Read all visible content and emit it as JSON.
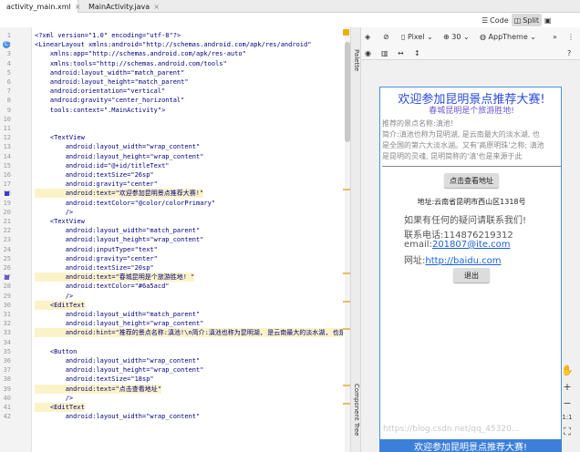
{
  "tabs": [
    {
      "label": "activity_main.xml",
      "close": "×",
      "icon": "xml-file-icon"
    },
    {
      "label": "MainActivity.java",
      "close": "×",
      "icon": "java-class-icon"
    }
  ],
  "view_modes": {
    "code": "Code",
    "split": "Split",
    "design": "Design"
  },
  "design_toolbar": {
    "device": "Pixel",
    "api": "30",
    "theme": "AppTheme",
    "help": "?"
  },
  "side_tabs": {
    "palette": "Palette",
    "component_tree": "Component Tree"
  },
  "line_numbers": [
    "1",
    "2",
    "3",
    "4",
    "5",
    "6",
    "7",
    "8",
    "9",
    "10",
    "11",
    "12",
    "13",
    "14",
    "15",
    "16",
    "17",
    "18",
    "19",
    "20",
    "21",
    "22",
    "23",
    "24",
    "25",
    "26",
    "27",
    "28",
    "29",
    "30",
    "31",
    "32",
    "33",
    "34",
    "35",
    "36",
    "37",
    "38",
    "39",
    "40",
    "41",
    "42",
    "43",
    "44"
  ],
  "code_lines": [
    {
      "text": "<?xml version=\"1.0\" encoding=\"utf-8\"?>",
      "hl": false
    },
    {
      "text": "<LinearLayout xmlns:android=\"http://schemas.android.com/apk/res/android\"",
      "hl": false
    },
    {
      "text": "    xmlns:app=\"http://schemas.android.com/apk/res-auto\"",
      "hl": false
    },
    {
      "text": "    xmlns:tools=\"http://schemas.android.com/tools\"",
      "hl": false
    },
    {
      "text": "    android:layout_width=\"match_parent\"",
      "hl": false
    },
    {
      "text": "    android:layout_height=\"match_parent\"",
      "hl": false
    },
    {
      "text": "    android:orientation=\"vertical\"",
      "hl": false
    },
    {
      "text": "    android:gravity=\"center_horizontal\"",
      "hl": false
    },
    {
      "text": "    tools:context=\".MainActivity\">",
      "hl": false
    },
    {
      "text": "",
      "hl": false
    },
    {
      "text": "",
      "hl": false
    },
    {
      "text": "    <TextView",
      "hl": false
    },
    {
      "text": "        android:layout_width=\"wrap_content\"",
      "hl": false
    },
    {
      "text": "        android:layout_height=\"wrap_content\"",
      "hl": false
    },
    {
      "text": "        android:id=\"@+id/titleText\"",
      "hl": false
    },
    {
      "text": "        android:textSize=\"26sp\"",
      "hl": false
    },
    {
      "text": "        android:gravity=\"center\"",
      "hl": false
    },
    {
      "text": "        android:text=\"欢迎参加昆明景点推荐大赛!\"",
      "hl": true
    },
    {
      "text": "        android:textColor=\"@color/colorPrimary\"",
      "hl": false
    },
    {
      "text": "        />",
      "hl": false
    },
    {
      "text": "    <TextView",
      "hl": false
    },
    {
      "text": "        android:layout_width=\"match_parent\"",
      "hl": false
    },
    {
      "text": "        android:layout_height=\"wrap_content\"",
      "hl": false
    },
    {
      "text": "        android:inputType=\"text\"",
      "hl": false
    },
    {
      "text": "        android:gravity=\"center\"",
      "hl": false
    },
    {
      "text": "        android:textSize=\"20sp\"",
      "hl": false
    },
    {
      "text": "        android:text=\"春城昆明是个旅游胜地! \"",
      "hl": true
    },
    {
      "text": "        android:textColor=\"#6a5acd\"",
      "hl": false
    },
    {
      "text": "        />",
      "hl": false
    },
    {
      "text": "    <EditText",
      "hl": true
    },
    {
      "text": "        android:layout_width=\"match_parent\"",
      "hl": false
    },
    {
      "text": "        android:layout_height=\"wrap_content\"",
      "hl": false
    },
    {
      "text": "        android:hint=\"推荐的景点名称:滇池!\\n简介:滇池也称为昆明湖, 是云南最大的淡水湖, 也是",
      "hl": true
    },
    {
      "text": "",
      "hl": false
    },
    {
      "text": "    <Button",
      "hl": false
    },
    {
      "text": "        android:layout_width=\"wrap_content\"",
      "hl": false
    },
    {
      "text": "        android:layout_height=\"wrap_content\"",
      "hl": false
    },
    {
      "text": "        android:textSize=\"18sp\"",
      "hl": false
    },
    {
      "text": "        android:text=\"点击查看地址\"",
      "hl": true
    },
    {
      "text": "        />",
      "hl": false
    },
    {
      "text": "    <EditText",
      "hl": true
    },
    {
      "text": "        android:layout_width=\"wrap_content\"",
      "hl": false
    }
  ],
  "preview": {
    "title": "欢迎参加昆明景点推荐大赛!",
    "title_color": "#2a4ad8",
    "subtitle": "春城昆明是个旅游胜地!",
    "subtitle_color": "#6a5acd",
    "hint_lines": [
      "推荐的景点名称:滇池!",
      "简介:滇池也称为昆明湖, 是云南最大的淡水湖, 也",
      "是全国的第六大淡水湖。又有'高原明珠'之称; 滇池",
      "是昆明的灵魂, 昆明简称的'滇'也是来源于此"
    ],
    "button_address": "点击查看地址",
    "address": "地址:云南省昆明市西山区1318号",
    "contact_title": "如果有任何的疑问请联系我们!",
    "phone": "联系电话:114876219312",
    "email_label": "email:",
    "email_value": "201807@ite.com",
    "site_label": "网址:",
    "site_value": "http://baidu.com",
    "exit": "退出",
    "bottom_strip": "欢迎参加昆明景点推荐大赛!"
  },
  "zoom": {
    "plus": "+",
    "minus": "−",
    "fit": "1:1",
    "pan": "✋"
  },
  "watermark": "https://blog.csdn.net/qq_45320..."
}
